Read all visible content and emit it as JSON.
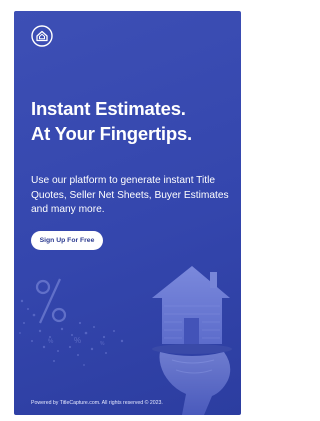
{
  "hero": {
    "headline_line1": "Instant Estimates.",
    "headline_line2": "At Your Fingertips.",
    "description": "Use our platform to generate instant Title Quotes, Seller Net Sheets, Buyer Estimates and many more.",
    "signup_label": "Sign Up For Free"
  },
  "footer": {
    "text": "Powered by TitleCapture.com. All rights reserved © 2023."
  },
  "colors": {
    "background": "#3446ad",
    "button_text": "#2b3a8f"
  },
  "icons": {
    "logo": "house-circle-icon",
    "illustration": "house-on-hand-icon",
    "percent": "percent-icon"
  }
}
